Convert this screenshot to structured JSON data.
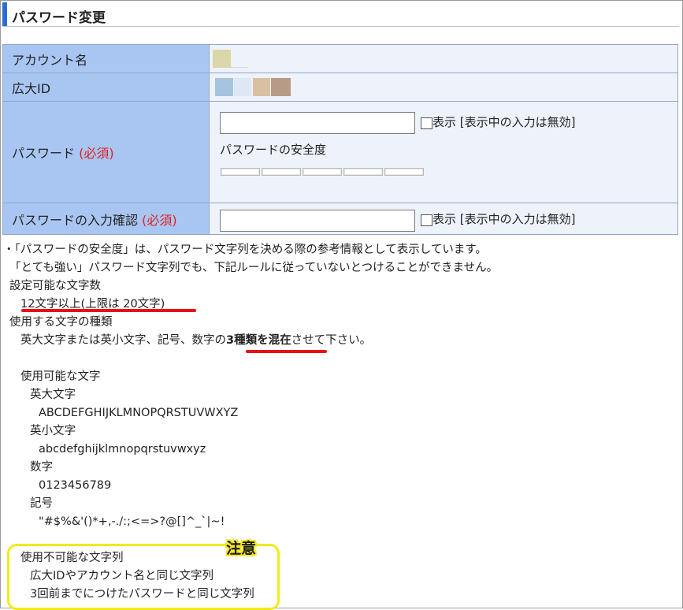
{
  "page": {
    "title": "パスワード変更"
  },
  "form": {
    "account_label": "アカウント名",
    "ad_id_label": "広大ID",
    "password_label": "パスワード",
    "required": "(必須)",
    "password_value": "",
    "show_label": "表示 [表示中の入力は無効]",
    "strength_label": "パスワードの安全度",
    "confirm_label": "パスワードの入力確認",
    "confirm_value": ""
  },
  "notes": {
    "line1": "・「パスワードの安全度」は、パスワード文字列を決める際の参考情報として表示しています。",
    "line2": "「とても強い」パスワード文字列でも、下記ルールに従っていないとつけることができません。",
    "settable_heading": "設定可能な文字数",
    "length_rule": "12文字以上(上限は 20文字)",
    "types_heading": "使用する文字の種類",
    "types_rule_pre": "英大文字または英小文字、記号、数字の",
    "types_rule_bold": "3種類を混在",
    "types_rule_post": "させて下さい。",
    "usable_heading": "使用可能な文字",
    "upper_label": "英大文字",
    "upper_chars": "ABCDEFGHIJKLMNOPQRSTUVWXYZ",
    "lower_label": "英小文字",
    "lower_chars": "abcdefghijklmnopqrstuvwxyz",
    "digit_label": "数字",
    "digit_chars": "0123456789",
    "symbol_label": "記号",
    "symbol_chars": "\"#$%&'()*+,-./:;<=>?@[]^_`|~!",
    "unusable_heading": "使用不可能な文字列",
    "unusable_1": "広大IDやアカウント名と同じ文字列",
    "unusable_2": "3回前までにつけたパスワードと同じ文字列",
    "caution_tag": "注意"
  },
  "colors": {
    "accent": "#2a6bd6",
    "label_bg": "#a9c6f2",
    "value_bg": "#eef2fa",
    "required": "#e02020",
    "annotation_red": "#e81010",
    "annotation_yellow": "#f2ea18"
  },
  "strength_meter": {
    "segments": 5,
    "filled": 0
  }
}
